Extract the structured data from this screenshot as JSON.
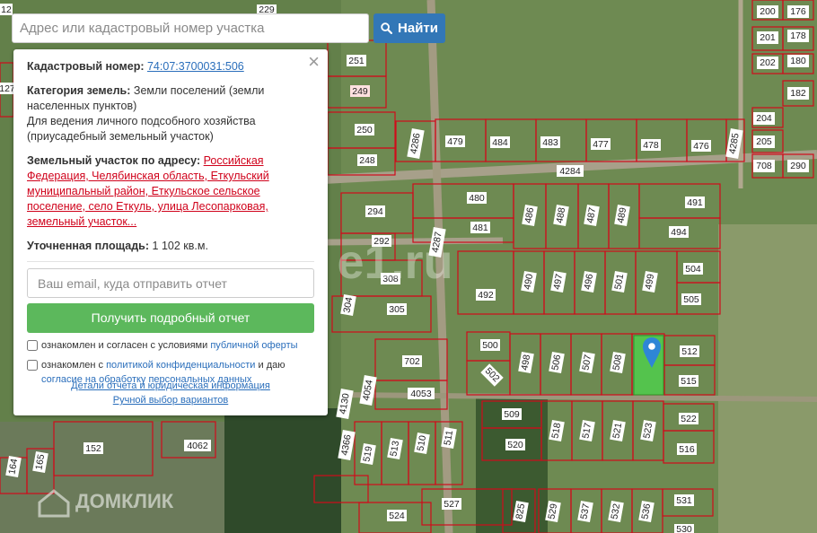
{
  "search": {
    "placeholder": "Адрес или кадастровый номер участка",
    "button_label": "Найти"
  },
  "panel": {
    "cadastral_label": "Кадастровый номер:",
    "cadastral_value": "74:07:3700031:506",
    "category_label": "Категория земель:",
    "category_value": "Земли поселений (земли населенных пунктов)",
    "usage": "Для ведения личного подсобного хозяйства (приусадебный земельный участок)",
    "address_label": "Земельный участок по адресу:",
    "address_value": "Российская Федерация, Челябинская область, Еткульский муниципальный район, Еткульское сельское поселение, село Еткуль, улица Лесопарковая, земельный участок...",
    "area_label": "Уточненная площадь:",
    "area_value": "1 102 кв.м.",
    "email_placeholder": "Ваш email, куда отправить отчет",
    "report_button": "Получить подробный отчет",
    "consent1_prefix": "ознакомлен и согласен с условиями",
    "consent1_link": "публичной оферты",
    "consent2_prefix": "ознакомлен с",
    "consent2_link1": "политикой конфиденциальности",
    "consent2_mid": "и даю",
    "consent2_link2": "согласие на обработку персональных данных",
    "link_details": "Детали отчета и юридическая информация",
    "link_manual": "Ручной выбор вариантов"
  },
  "watermarks": {
    "domclick": "ДОМКЛИК",
    "center": "e1.ru"
  },
  "map_labels": {
    "p229": "229",
    "p200": "200",
    "p176": "176",
    "p201": "201",
    "p178": "178",
    "p202": "202",
    "p180": "180",
    "p182": "182",
    "p204": "204",
    "p205": "205",
    "p708": "708",
    "p290": "290",
    "p251": "251",
    "p249": "249",
    "p250": "250",
    "p248": "248",
    "p4286": "4286",
    "p479": "479",
    "p484": "484",
    "p483": "483",
    "p477": "477",
    "p478": "478",
    "p476": "476",
    "p4285": "4285",
    "p4284": "4284",
    "p480": "480",
    "p481": "481",
    "p486": "486",
    "p488": "488",
    "p487": "487",
    "p489": "489",
    "p491": "491",
    "p494": "494",
    "p294": "294",
    "p292": "292",
    "p4287": "4287",
    "p308": "308",
    "p305": "305",
    "p304": "304",
    "p492": "492",
    "p490": "490",
    "p497": "497",
    "p496": "496",
    "p501": "501",
    "p499": "499",
    "p504": "504",
    "p505": "505",
    "p500": "500",
    "p502": "502",
    "p498": "498",
    "p506": "506",
    "p507": "507",
    "p508": "508",
    "p512": "512",
    "p515": "515",
    "p702": "702",
    "p4053": "4053",
    "p4054": "4054",
    "p4130": "4130",
    "p509": "509",
    "p520": "520",
    "p518": "518",
    "p517": "517",
    "p521": "521",
    "p523": "523",
    "p522": "522",
    "p516": "516",
    "p152": "152",
    "p4062": "4062",
    "p4366": "4366",
    "p519": "519",
    "p513": "513",
    "p510": "510",
    "p511": "511",
    "p164": "164",
    "p165": "165",
    "p527": "527",
    "p524": "524",
    "p825": "825",
    "p529": "529",
    "p537": "537",
    "p532": "532",
    "p536": "536",
    "p531": "531",
    "p530": "530",
    "p12": "12",
    "p127": "127"
  }
}
